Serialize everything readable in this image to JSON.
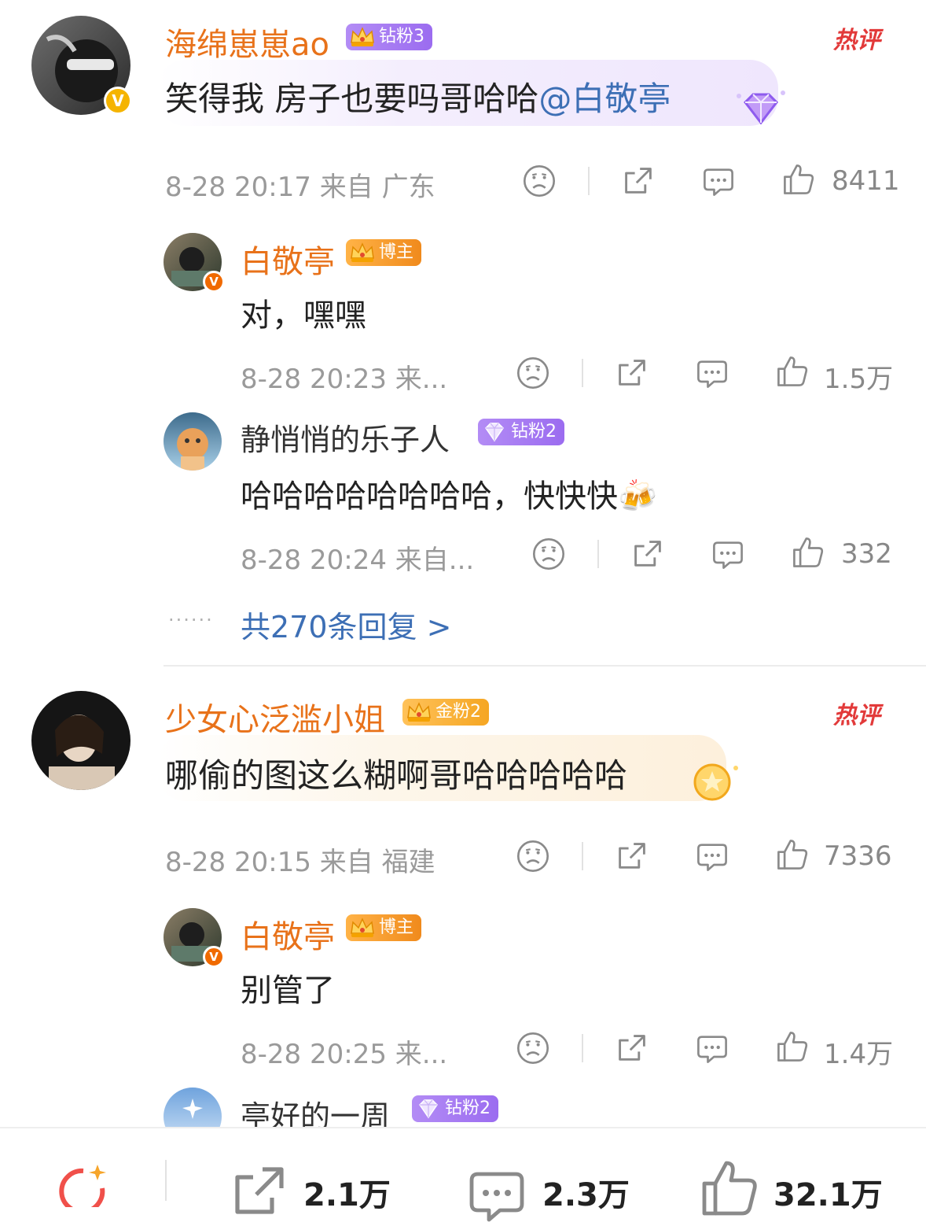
{
  "colors": {
    "username": "#e8721a",
    "mention": "#3d6fb5",
    "meta": "#9a9a9a",
    "hot_badge": "#e23a3a",
    "diamond_pill": "#9b6cf0",
    "gold_pill": "#f5a623",
    "blogger_pill": "#f08a1c"
  },
  "comments": [
    {
      "username": "海绵崽崽ao",
      "badge": "钻粉3",
      "hot_label": "热评",
      "text_prefix": "笑得我 房子也要吗哥哈哈",
      "mention": "@白敬亭",
      "meta": "8-28 20:17  来自 广东",
      "likes": "8411",
      "icons": [
        "dislike-icon",
        "share-icon",
        "comment-icon",
        "like-icon"
      ],
      "replies": [
        {
          "username": "白敬亭",
          "badge": "博主",
          "text": "对，嘿嘿",
          "meta": "8-28 20:23  来...",
          "likes": "1.5万"
        },
        {
          "username": "静悄悄的乐子人",
          "badge": "钻粉2",
          "text": "哈哈哈哈哈哈哈哈，快快快",
          "emoji": "🍻",
          "meta": "8-28 20:24  来自...",
          "likes": "332"
        }
      ],
      "more_replies": "共270条回复 >"
    },
    {
      "username": "少女心泛滥小姐",
      "badge": "金粉2",
      "hot_label": "热评",
      "text": "哪偷的图这么糊啊哥哈哈哈哈哈",
      "meta": "8-28 20:15  来自 福建",
      "likes": "7336",
      "replies": [
        {
          "username": "白敬亭",
          "badge": "博主",
          "text": "别管了",
          "meta": "8-28 20:25  来...",
          "likes": "1.4万"
        },
        {
          "username": "亭好的一周",
          "badge": "钻粉2"
        }
      ]
    }
  ],
  "bottom_bar": {
    "share_count": "2.1万",
    "comment_count": "2.3万",
    "like_count": "32.1万",
    "icons": [
      "refresh-icon",
      "share-icon",
      "comment-icon",
      "like-icon"
    ]
  }
}
